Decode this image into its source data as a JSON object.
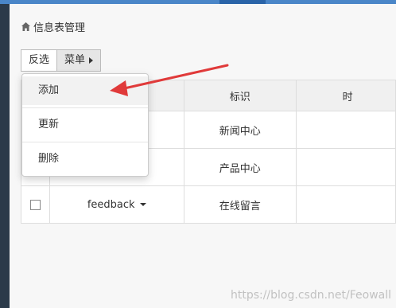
{
  "breadcrumb": {
    "icon": "home-icon",
    "label": "信息表管理"
  },
  "toolbar": {
    "invert_label": "反选",
    "menu_label": "菜单"
  },
  "menu": {
    "items": [
      {
        "label": "添加"
      },
      {
        "label": "更新"
      },
      {
        "label": "删除"
      }
    ]
  },
  "table": {
    "headers": {
      "identifier": "标识",
      "partial": "时"
    },
    "rows": [
      {
        "name": "",
        "identifier": "新闻中心"
      },
      {
        "name": "",
        "identifier": "产品中心"
      },
      {
        "name": "feedback",
        "identifier": "在线留言"
      }
    ]
  },
  "watermark": "https://blog.csdn.net/Feowall",
  "colors": {
    "top_bar": "#4a86c8",
    "sidebar": "#2b3a4a",
    "arrow": "#e03a3a"
  }
}
